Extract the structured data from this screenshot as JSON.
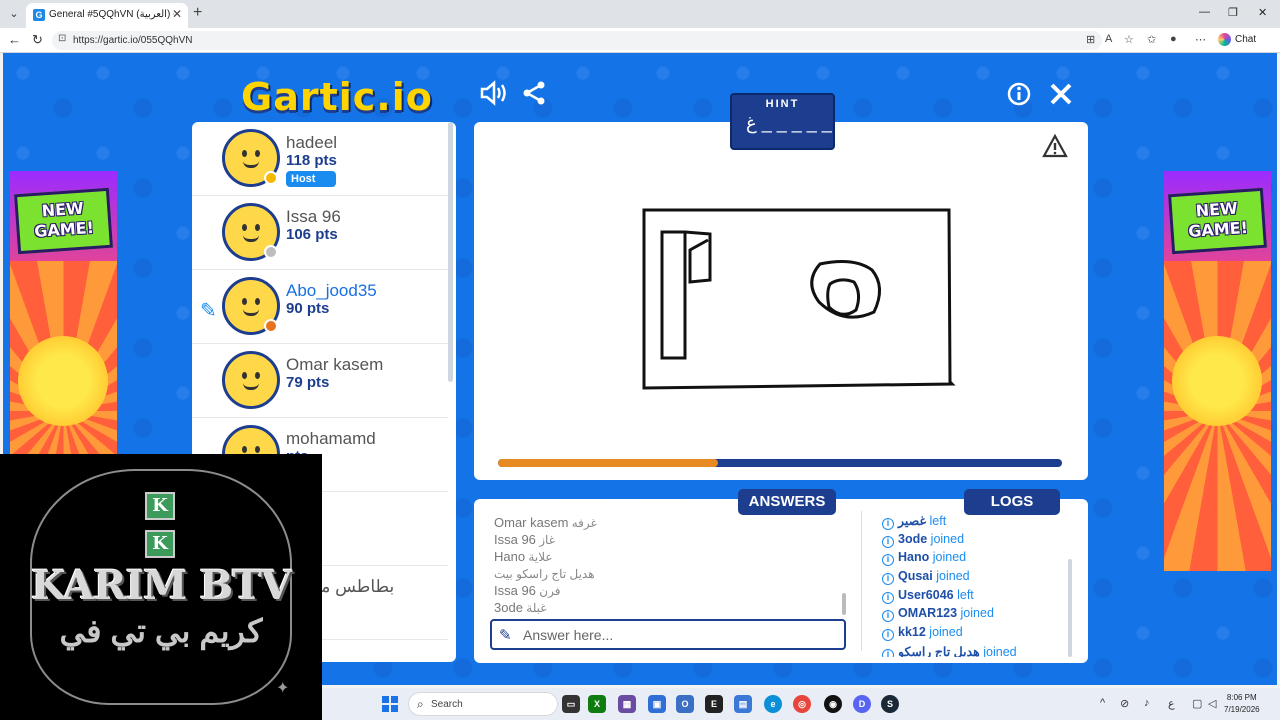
{
  "browser": {
    "tab_title": "General #5QQhVN (العربية) - Gartic.io",
    "url": "https://gartic.io/055QQhVN",
    "chat_label": "Chat"
  },
  "game": {
    "logo": "Gartic.io",
    "banner_text": "NEW GAME!",
    "hint_label": "HINT",
    "hint_word": "غ _ _ _ _ _",
    "progress_fraction": 0.39,
    "answers_tab": "ANSWERS",
    "logs_tab": "LOGS",
    "answer_placeholder": "Answer here...",
    "players": [
      {
        "name": "hadeel",
        "pts": "118 pts",
        "host": "Host",
        "dot": "#f5b800",
        "drawing": false
      },
      {
        "name": "Issa 96",
        "pts": "106 pts",
        "host": "",
        "dot": "#bdbdbd",
        "drawing": false
      },
      {
        "name": "Abo_jood35",
        "pts": "90 pts",
        "host": "",
        "dot": "#e8731f",
        "drawing": true
      },
      {
        "name": "Omar kasem",
        "pts": "79 pts",
        "host": "",
        "dot": "",
        "drawing": false
      },
      {
        "name": "mohamamd",
        "pts": "pts",
        "host": "",
        "dot": "",
        "drawing": false
      },
      {
        "name": "",
        "pts": "pts",
        "host": "",
        "dot": "",
        "drawing": false
      },
      {
        "name": "بطاطس ملتهب",
        "pts": "pts",
        "host": "",
        "dot": "",
        "drawing": false
      }
    ],
    "answers": [
      {
        "user": "Omar kasem",
        "text": "غرفه"
      },
      {
        "user": "Issa 96",
        "text": "غاز"
      },
      {
        "user": "Hano",
        "text": "علاية"
      },
      {
        "user": "",
        "text": "هديل تاج راسكو بيت"
      },
      {
        "user": "Issa 96",
        "text": "فرن"
      },
      {
        "user": "3ode",
        "text": "غبلة"
      }
    ],
    "logs": [
      {
        "user": "غصير",
        "action": "left"
      },
      {
        "user": "3ode",
        "action": "joined"
      },
      {
        "user": "Hano",
        "action": "joined"
      },
      {
        "user": "Qusai",
        "action": "joined"
      },
      {
        "user": "User6046",
        "action": "left"
      },
      {
        "user": "OMAR123",
        "action": "joined"
      },
      {
        "user": "kk12",
        "action": "joined"
      },
      {
        "user": "هديل تاج راسكو",
        "action": "joined"
      }
    ]
  },
  "overlay": {
    "title": "KARIM BTV",
    "subtitle": "كريم بي تي في",
    "letter": "K"
  },
  "taskbar": {
    "search_label": "Search",
    "time": "8:06 PM",
    "date": "7/19/2026"
  }
}
